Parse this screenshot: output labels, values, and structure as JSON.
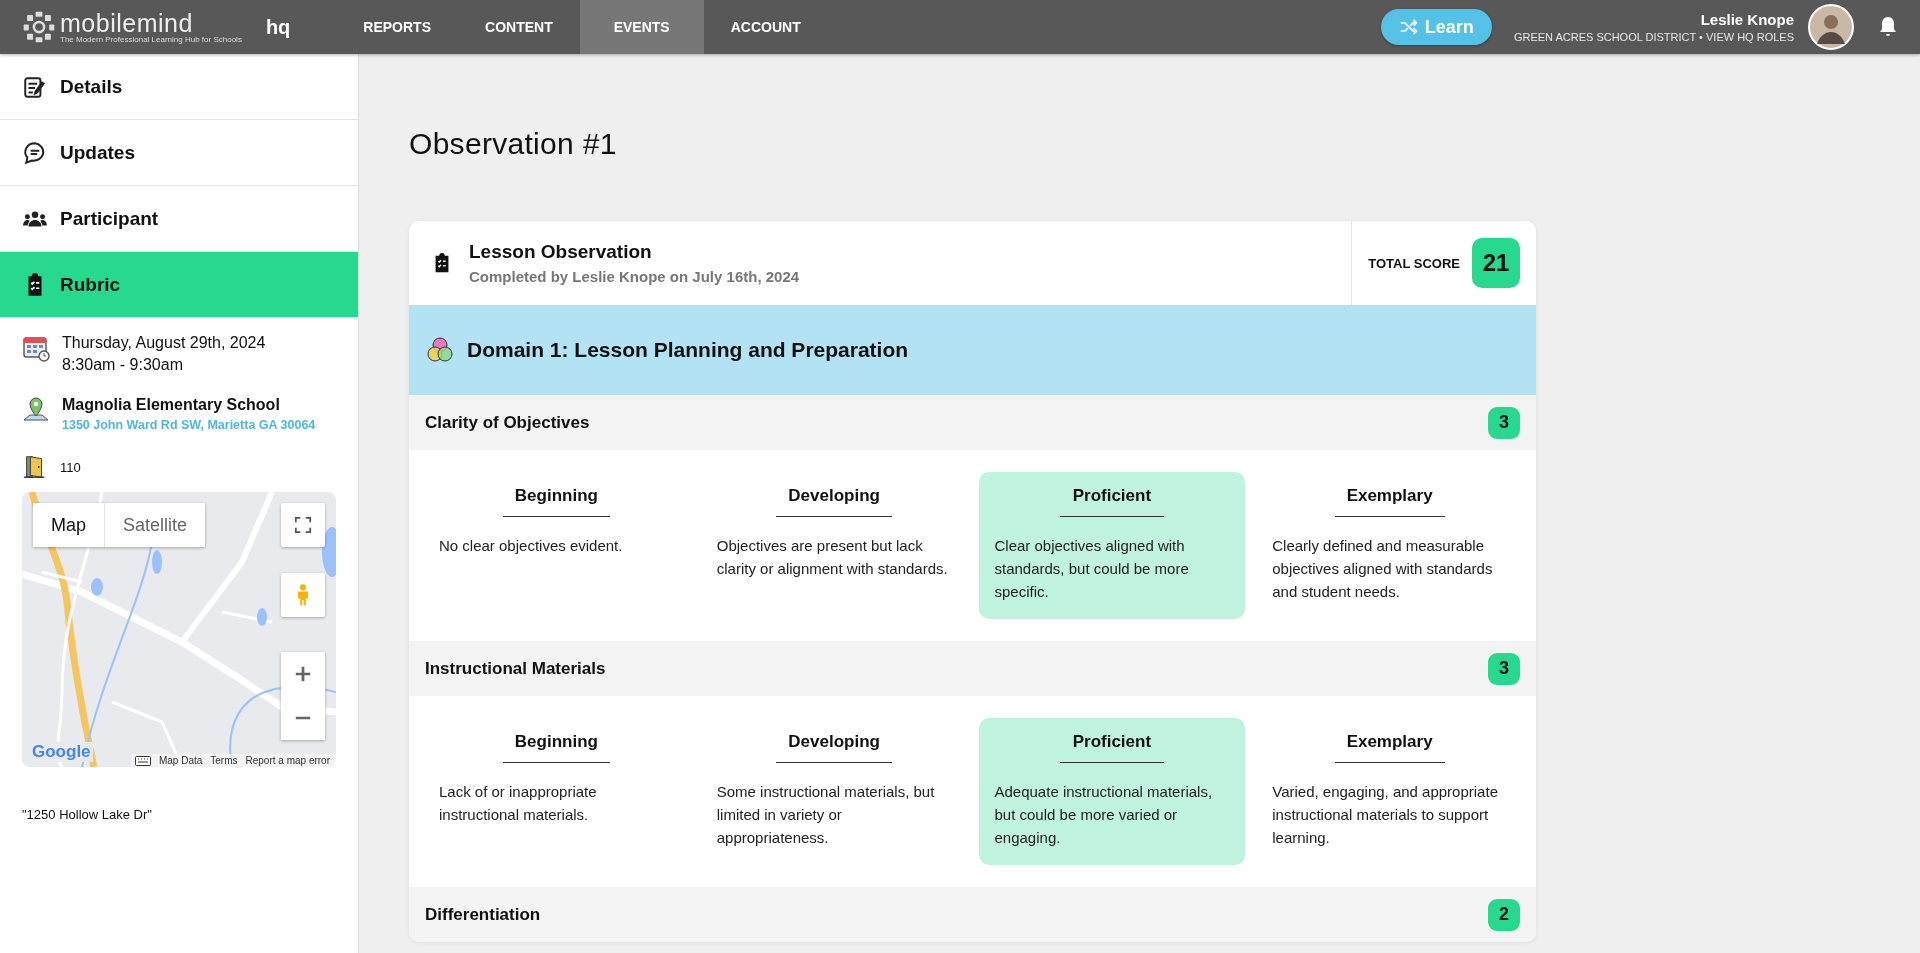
{
  "top_bar": {
    "logo": {
      "name": "mobilemind",
      "tagline": "The Modern Professional Learning Hub for Schools",
      "suffix": "hq"
    },
    "nav": [
      {
        "label": "REPORTS",
        "selected": false
      },
      {
        "label": "CONTENT",
        "selected": false
      },
      {
        "label": "EVENTS",
        "selected": true
      },
      {
        "label": "ACCOUNT",
        "selected": false
      }
    ],
    "learn_button": "Learn",
    "user": {
      "name": "Leslie Knope",
      "org": "GREEN ACRES SCHOOL DISTRICT • VIEW HQ ROLES"
    }
  },
  "sidebar": {
    "items": [
      {
        "label": "Details",
        "selected": false
      },
      {
        "label": "Updates",
        "selected": false
      },
      {
        "label": "Participant",
        "selected": false
      },
      {
        "label": "Rubric",
        "selected": true
      }
    ],
    "event": {
      "date": "Thursday, August 29th, 2024",
      "time": "8:30am - 9:30am",
      "location": "Magnolia Elementary School",
      "address": "1350 John Ward Rd SW, Marietta GA 30064",
      "room": "110"
    },
    "map": {
      "types": [
        {
          "label": "Map",
          "selected": true
        },
        {
          "label": "Satellite",
          "selected": false
        }
      ],
      "logo": "Google",
      "footer": [
        "Map Data",
        "Terms",
        "Report a map error"
      ]
    },
    "note": "\"1250 Hollow Lake Dr\""
  },
  "main": {
    "title": "Observation #1",
    "rubric": {
      "title": "Lesson Observation",
      "subtitle": "Completed by Leslie Knope on July 16th, 2024",
      "total_label": "TOTAL SCORE",
      "total": "21",
      "domain": "Domain 1: Lesson Planning and Preparation",
      "criteria": [
        {
          "name": "Clarity of Objectives",
          "score": "3",
          "levels": [
            {
              "name": "Beginning",
              "description": "No clear objectives evident.",
              "selected": false
            },
            {
              "name": "Developing",
              "description": "Objectives are present but lack clarity or alignment with standards.",
              "selected": false
            },
            {
              "name": "Proficient",
              "description": "Clear objectives aligned with standards, but could be more specific.",
              "selected": true
            },
            {
              "name": "Exemplary",
              "description": "Clearly defined and measurable objectives aligned with standards and student needs.",
              "selected": false
            }
          ]
        },
        {
          "name": "Instructional Materials",
          "score": "3",
          "levels": [
            {
              "name": "Beginning",
              "description": "Lack of or inappropriate instructional materials.",
              "selected": false
            },
            {
              "name": "Developing",
              "description": "Some instructional materials, but limited in variety or appropriateness.",
              "selected": false
            },
            {
              "name": "Proficient",
              "description": "Adequate instructional materials, but could be more varied or engaging.",
              "selected": true
            },
            {
              "name": "Exemplary",
              "description": "Varied, engaging, and appropriate instructional materials to support learning.",
              "selected": false
            }
          ]
        },
        {
          "name": "Differentiation",
          "score": "2"
        }
      ]
    }
  }
}
